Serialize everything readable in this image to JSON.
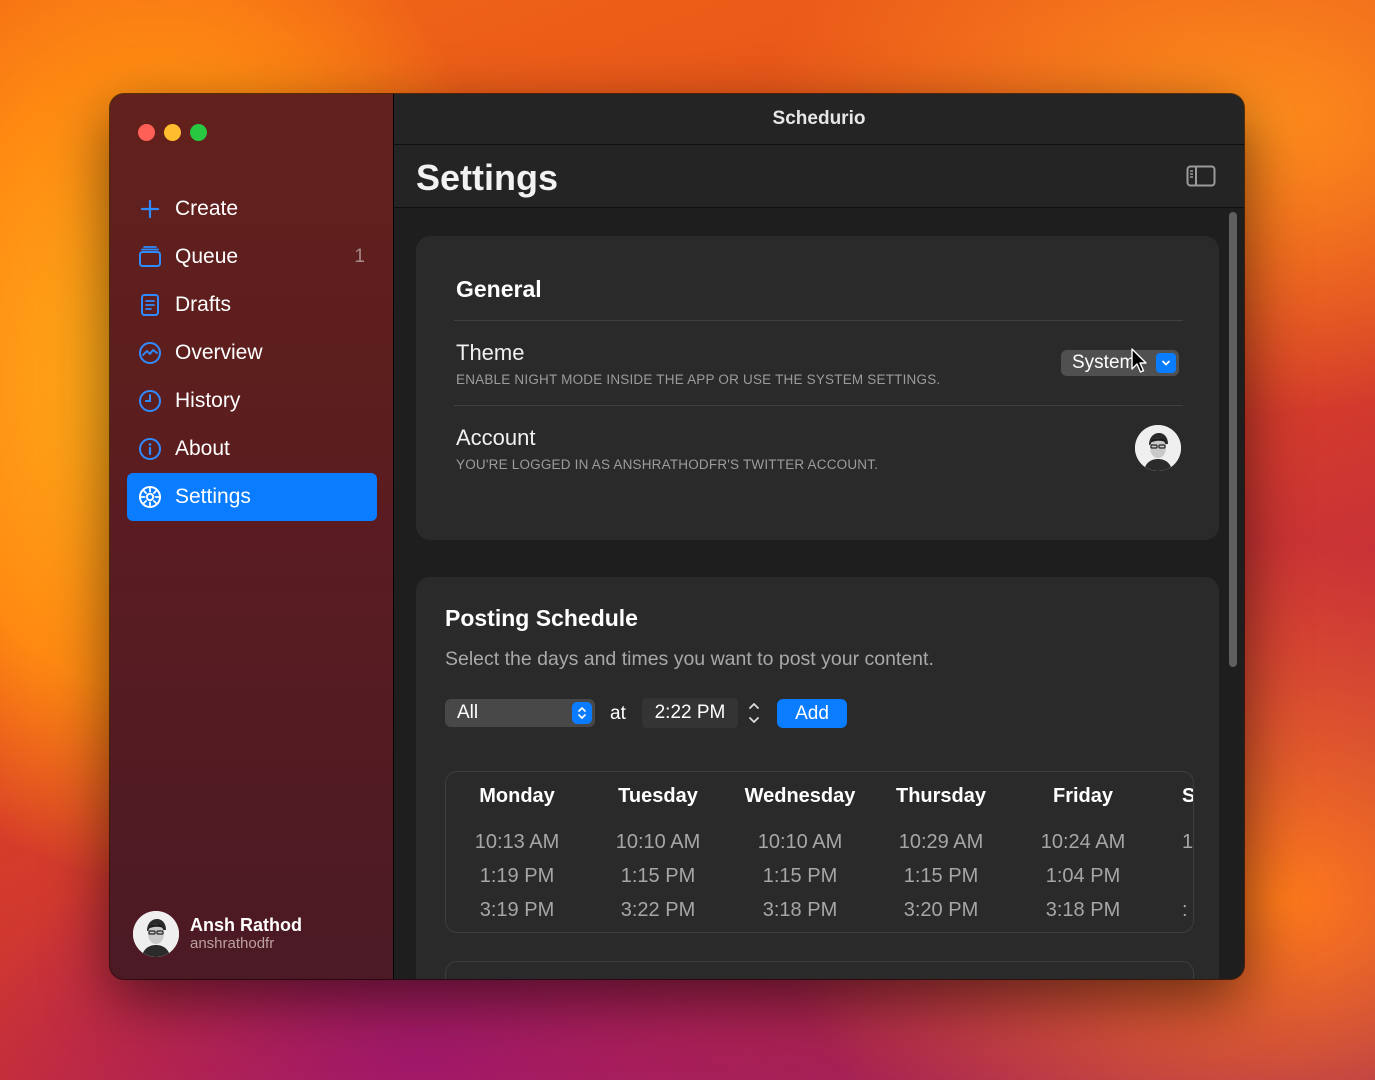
{
  "window": {
    "title": "Schedurio"
  },
  "sidebar": {
    "items": [
      {
        "label": "Create",
        "icon": "plus-icon"
      },
      {
        "label": "Queue",
        "icon": "queue-icon",
        "count": "1"
      },
      {
        "label": "Drafts",
        "icon": "drafts-icon"
      },
      {
        "label": "Overview",
        "icon": "overview-icon"
      },
      {
        "label": "History",
        "icon": "clock-icon"
      },
      {
        "label": "About",
        "icon": "info-icon"
      },
      {
        "label": "Settings",
        "icon": "gear-icon",
        "active": true
      }
    ],
    "profile": {
      "name": "Ansh Rathod",
      "handle": "anshrathodfr"
    }
  },
  "header": {
    "title": "Settings"
  },
  "general": {
    "title": "General",
    "theme": {
      "title": "Theme",
      "subtitle": "ENABLE NIGHT MODE INSIDE THE APP OR USE THE SYSTEM SETTINGS.",
      "value": "System"
    },
    "account": {
      "title": "Account",
      "subtitle": "YOU'RE LOGGED IN AS ANSHRATHODFR'S TWITTER ACCOUNT."
    }
  },
  "schedule": {
    "title": "Posting Schedule",
    "subtitle": "Select the days and times you want to post your content.",
    "day_value": "All",
    "at_label": "at",
    "time_value": "2:22 PM",
    "add_label": "Add",
    "days": [
      {
        "name": "Monday",
        "times": [
          "10:13 AM",
          "1:19 PM",
          "3:19 PM"
        ]
      },
      {
        "name": "Tuesday",
        "times": [
          "10:10 AM",
          "1:15 PM",
          "3:22 PM"
        ]
      },
      {
        "name": "Wednesday",
        "times": [
          "10:10 AM",
          "1:15 PM",
          "3:18 PM"
        ]
      },
      {
        "name": "Thursday",
        "times": [
          "10:29 AM",
          "1:15 PM",
          "3:20 PM"
        ]
      },
      {
        "name": "Friday",
        "times": [
          "10:24 AM",
          "1:04 PM",
          "3:18 PM"
        ]
      },
      {
        "name": "S",
        "times": [
          "1",
          "",
          ":"
        ]
      }
    ]
  },
  "colors": {
    "accent": "#0a7cff",
    "sidebar_bg": "#5a1c20",
    "content_bg": "#1e1e1e",
    "card_bg": "#2a2a2a"
  }
}
